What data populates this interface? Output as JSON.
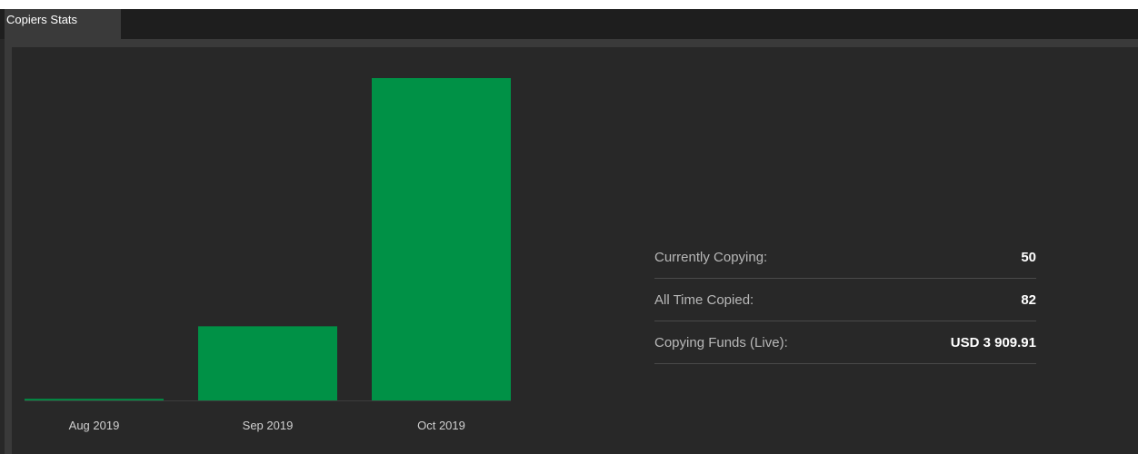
{
  "tab": {
    "label": "Copiers Stats"
  },
  "colors": {
    "bar": "#009146",
    "axis_text": "#d0d0d0"
  },
  "chart_data": {
    "type": "bar",
    "categories": [
      "Aug 2019",
      "Sep 2019",
      "Oct 2019"
    ],
    "values": [
      0.5,
      23,
      100
    ],
    "ylim": [
      0,
      100
    ],
    "grid": false,
    "title": "",
    "xlabel": "",
    "ylabel": ""
  },
  "stats": [
    {
      "label": "Currently Copying:",
      "value": "50"
    },
    {
      "label": "All Time Copied:",
      "value": "82"
    },
    {
      "label": "Copying Funds (Live):",
      "value": "USD 3 909.91"
    }
  ]
}
